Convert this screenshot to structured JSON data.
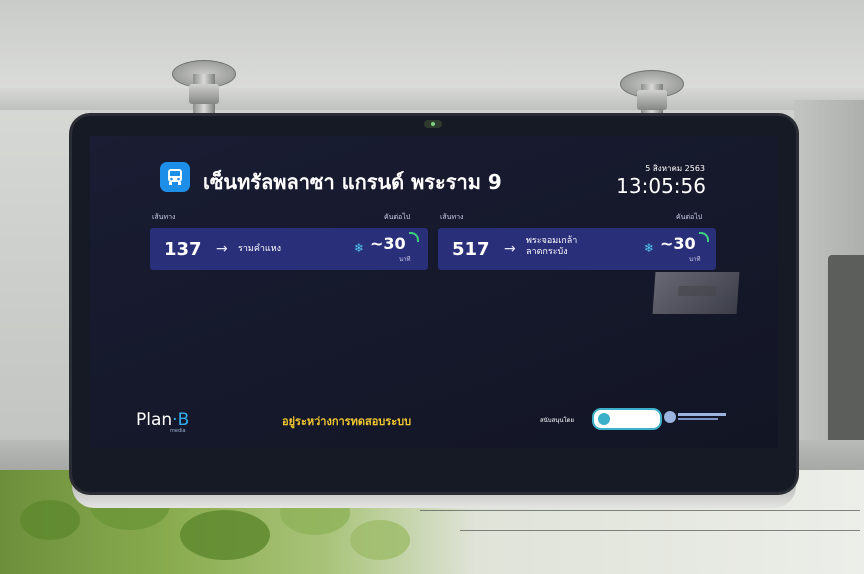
{
  "header": {
    "stop_name": "เซ็นทรัลพลาซา แกรนด์ พระราม 9",
    "date": "5 สิงหาคม 2563",
    "time": "13:05:56"
  },
  "columns": {
    "route_label": "เส้นทาง",
    "arrival_label": "คันต่อไป"
  },
  "routes": [
    {
      "number": "137",
      "destination": [
        "รามคำแหง"
      ],
      "eta": "~30",
      "unit": "นาที"
    },
    {
      "number": "517",
      "destination": [
        "พระจอมเกล้า",
        "ลาดกระบัง"
      ],
      "eta": "~30",
      "unit": "นาที"
    }
  ],
  "footer": {
    "logo_main": "Plan",
    "logo_b": "B",
    "logo_sub": "media",
    "status": "อยู่ระหว่างการทดสอบระบบ",
    "supported_by": "สนับสนุนโดย"
  },
  "colors": {
    "screen_bg": "#15182a",
    "route_card": "#2a2f7a",
    "accent_blue": "#1d8fe8",
    "status_yellow": "#f2c82f",
    "signal_green": "#3bd07a"
  },
  "icons": {
    "bus": "bus-icon",
    "arrow": "arrow-right-icon",
    "air_con": "snowflake-icon",
    "realtime": "signal-icon"
  }
}
